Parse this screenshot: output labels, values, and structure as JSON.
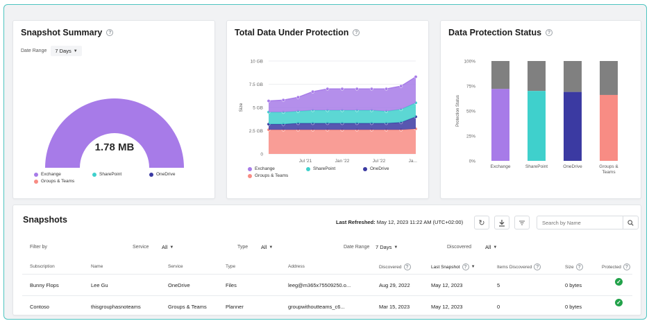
{
  "snapshot_summary": {
    "title": "Snapshot Summary",
    "date_range_label": "Date Range",
    "date_range_value": "7 Days",
    "total": "1.78 MB",
    "gauge_color": "#a77be8",
    "legend": [
      {
        "label": "Exchange",
        "color": "#a77be8"
      },
      {
        "label": "SharePoint",
        "color": "#3fd0cc"
      },
      {
        "label": "OneDrive",
        "color": "#3b3aa2"
      },
      {
        "label": "Groups & Teams",
        "color": "#f88c84"
      }
    ]
  },
  "total_data": {
    "title": "Total Data Under Protection",
    "ylabel": "Size",
    "legend": [
      {
        "label": "Exchange",
        "color": "#a77be8"
      },
      {
        "label": "SharePoint",
        "color": "#3fd0cc"
      },
      {
        "label": "OneDrive",
        "color": "#3b3aa2"
      },
      {
        "label": "Groups & Teams",
        "color": "#f88c84"
      }
    ]
  },
  "protection_status": {
    "title": "Data Protection Status",
    "ylabel": "Protection Status",
    "legend": []
  },
  "snapshots": {
    "title": "Snapshots",
    "last_refreshed_label": "Last Refreshed:",
    "last_refreshed_value": "May 12, 2023 11:22 AM (UTC+02:00)",
    "search_placeholder": "Search by Name",
    "filter_by": "Filter by",
    "filters": {
      "service_label": "Service",
      "service_value": "All",
      "type_label": "Type",
      "type_value": "All",
      "date_range_label": "Date Range",
      "date_range_value": "7 Days",
      "discovered_label": "Discovered",
      "discovered_value": "All"
    },
    "columns": {
      "subscription": "Subscription",
      "name": "Name",
      "service": "Service",
      "type": "Type",
      "address": "Address",
      "discovered": "Discovered",
      "last_snapshot": "Last Snapshot",
      "items_discovered": "Items Discovered",
      "size": "Size",
      "protected": "Protected"
    },
    "rows": [
      {
        "subscription": "Bunny Flops",
        "name": "Lee Gu",
        "service": "OneDrive",
        "type": "Files",
        "address": "leeg@m365x75509250.o...",
        "discovered": "Aug 29, 2022",
        "last_snapshot": "May 12, 2023",
        "items": "5",
        "size": "0 bytes"
      },
      {
        "subscription": "Contoso",
        "name": "thisgrouphasnoteams",
        "service": "Groups & Teams",
        "type": "Planner",
        "address": "groupwithoutteams_c6...",
        "discovered": "Mar 15, 2023",
        "last_snapshot": "May 12, 2023",
        "items": "0",
        "size": "0 bytes"
      }
    ],
    "protected_color": "#22a24a"
  },
  "chart_data": [
    {
      "type": "pie",
      "title": "Snapshot Summary",
      "center_label": "1.78 MB",
      "categories": [
        "Exchange",
        "SharePoint",
        "OneDrive",
        "Groups & Teams"
      ],
      "values": [
        1.78,
        0,
        0,
        0
      ],
      "colors": [
        "#a77be8",
        "#3fd0cc",
        "#3b3aa2",
        "#f88c84"
      ]
    },
    {
      "type": "area",
      "title": "Total Data Under Protection",
      "ylabel": "Size",
      "yticks": [
        "0",
        "2.5 GB",
        "5 GB",
        "7.5 GB",
        "10 GB"
      ],
      "ylim": [
        0,
        10
      ],
      "xticks": [
        {
          "label": "Jul '21",
          "x": 2.5
        },
        {
          "label": "Jan '22",
          "x": 5
        },
        {
          "label": "Jul '22",
          "x": 7.5
        },
        {
          "label": "Ja...",
          "x": 9.8
        }
      ],
      "x": [
        0,
        1,
        2,
        3,
        4,
        5,
        6,
        7,
        8,
        9,
        10
      ],
      "series": [
        {
          "name": "Groups & Teams",
          "color": "#f88c84",
          "values": [
            2.6,
            2.6,
            2.6,
            2.6,
            2.6,
            2.6,
            2.6,
            2.6,
            2.6,
            2.6,
            2.7
          ]
        },
        {
          "name": "OneDrive",
          "color": "#3b3aa2",
          "values": [
            0.6,
            0.6,
            0.7,
            0.7,
            0.7,
            0.7,
            0.7,
            0.7,
            0.7,
            0.8,
            1.3
          ]
        },
        {
          "name": "SharePoint",
          "color": "#3fd0cc",
          "values": [
            1.3,
            1.3,
            1.3,
            1.4,
            1.4,
            1.4,
            1.4,
            1.4,
            1.3,
            1.4,
            1.5
          ]
        },
        {
          "name": "Exchange",
          "color": "#a77be8",
          "values": [
            1.2,
            1.3,
            1.5,
            2.0,
            2.3,
            2.3,
            2.3,
            2.3,
            2.4,
            2.5,
            2.8
          ]
        }
      ]
    },
    {
      "type": "bar",
      "title": "Data Protection Status",
      "ylabel": "Protection Status",
      "categories": [
        "Exchange",
        "SharePoint",
        "OneDrive",
        "Groups & Teams"
      ],
      "yticks": [
        "0%",
        "25%",
        "50%",
        "75%",
        "100%"
      ],
      "ylim": [
        0,
        100
      ],
      "colors": [
        "#a77be8",
        "#3fd0cc",
        "#3b3aa2",
        "#f88c84"
      ],
      "protected": [
        72,
        70,
        69,
        66
      ],
      "unprotected_color": "#808080"
    }
  ]
}
